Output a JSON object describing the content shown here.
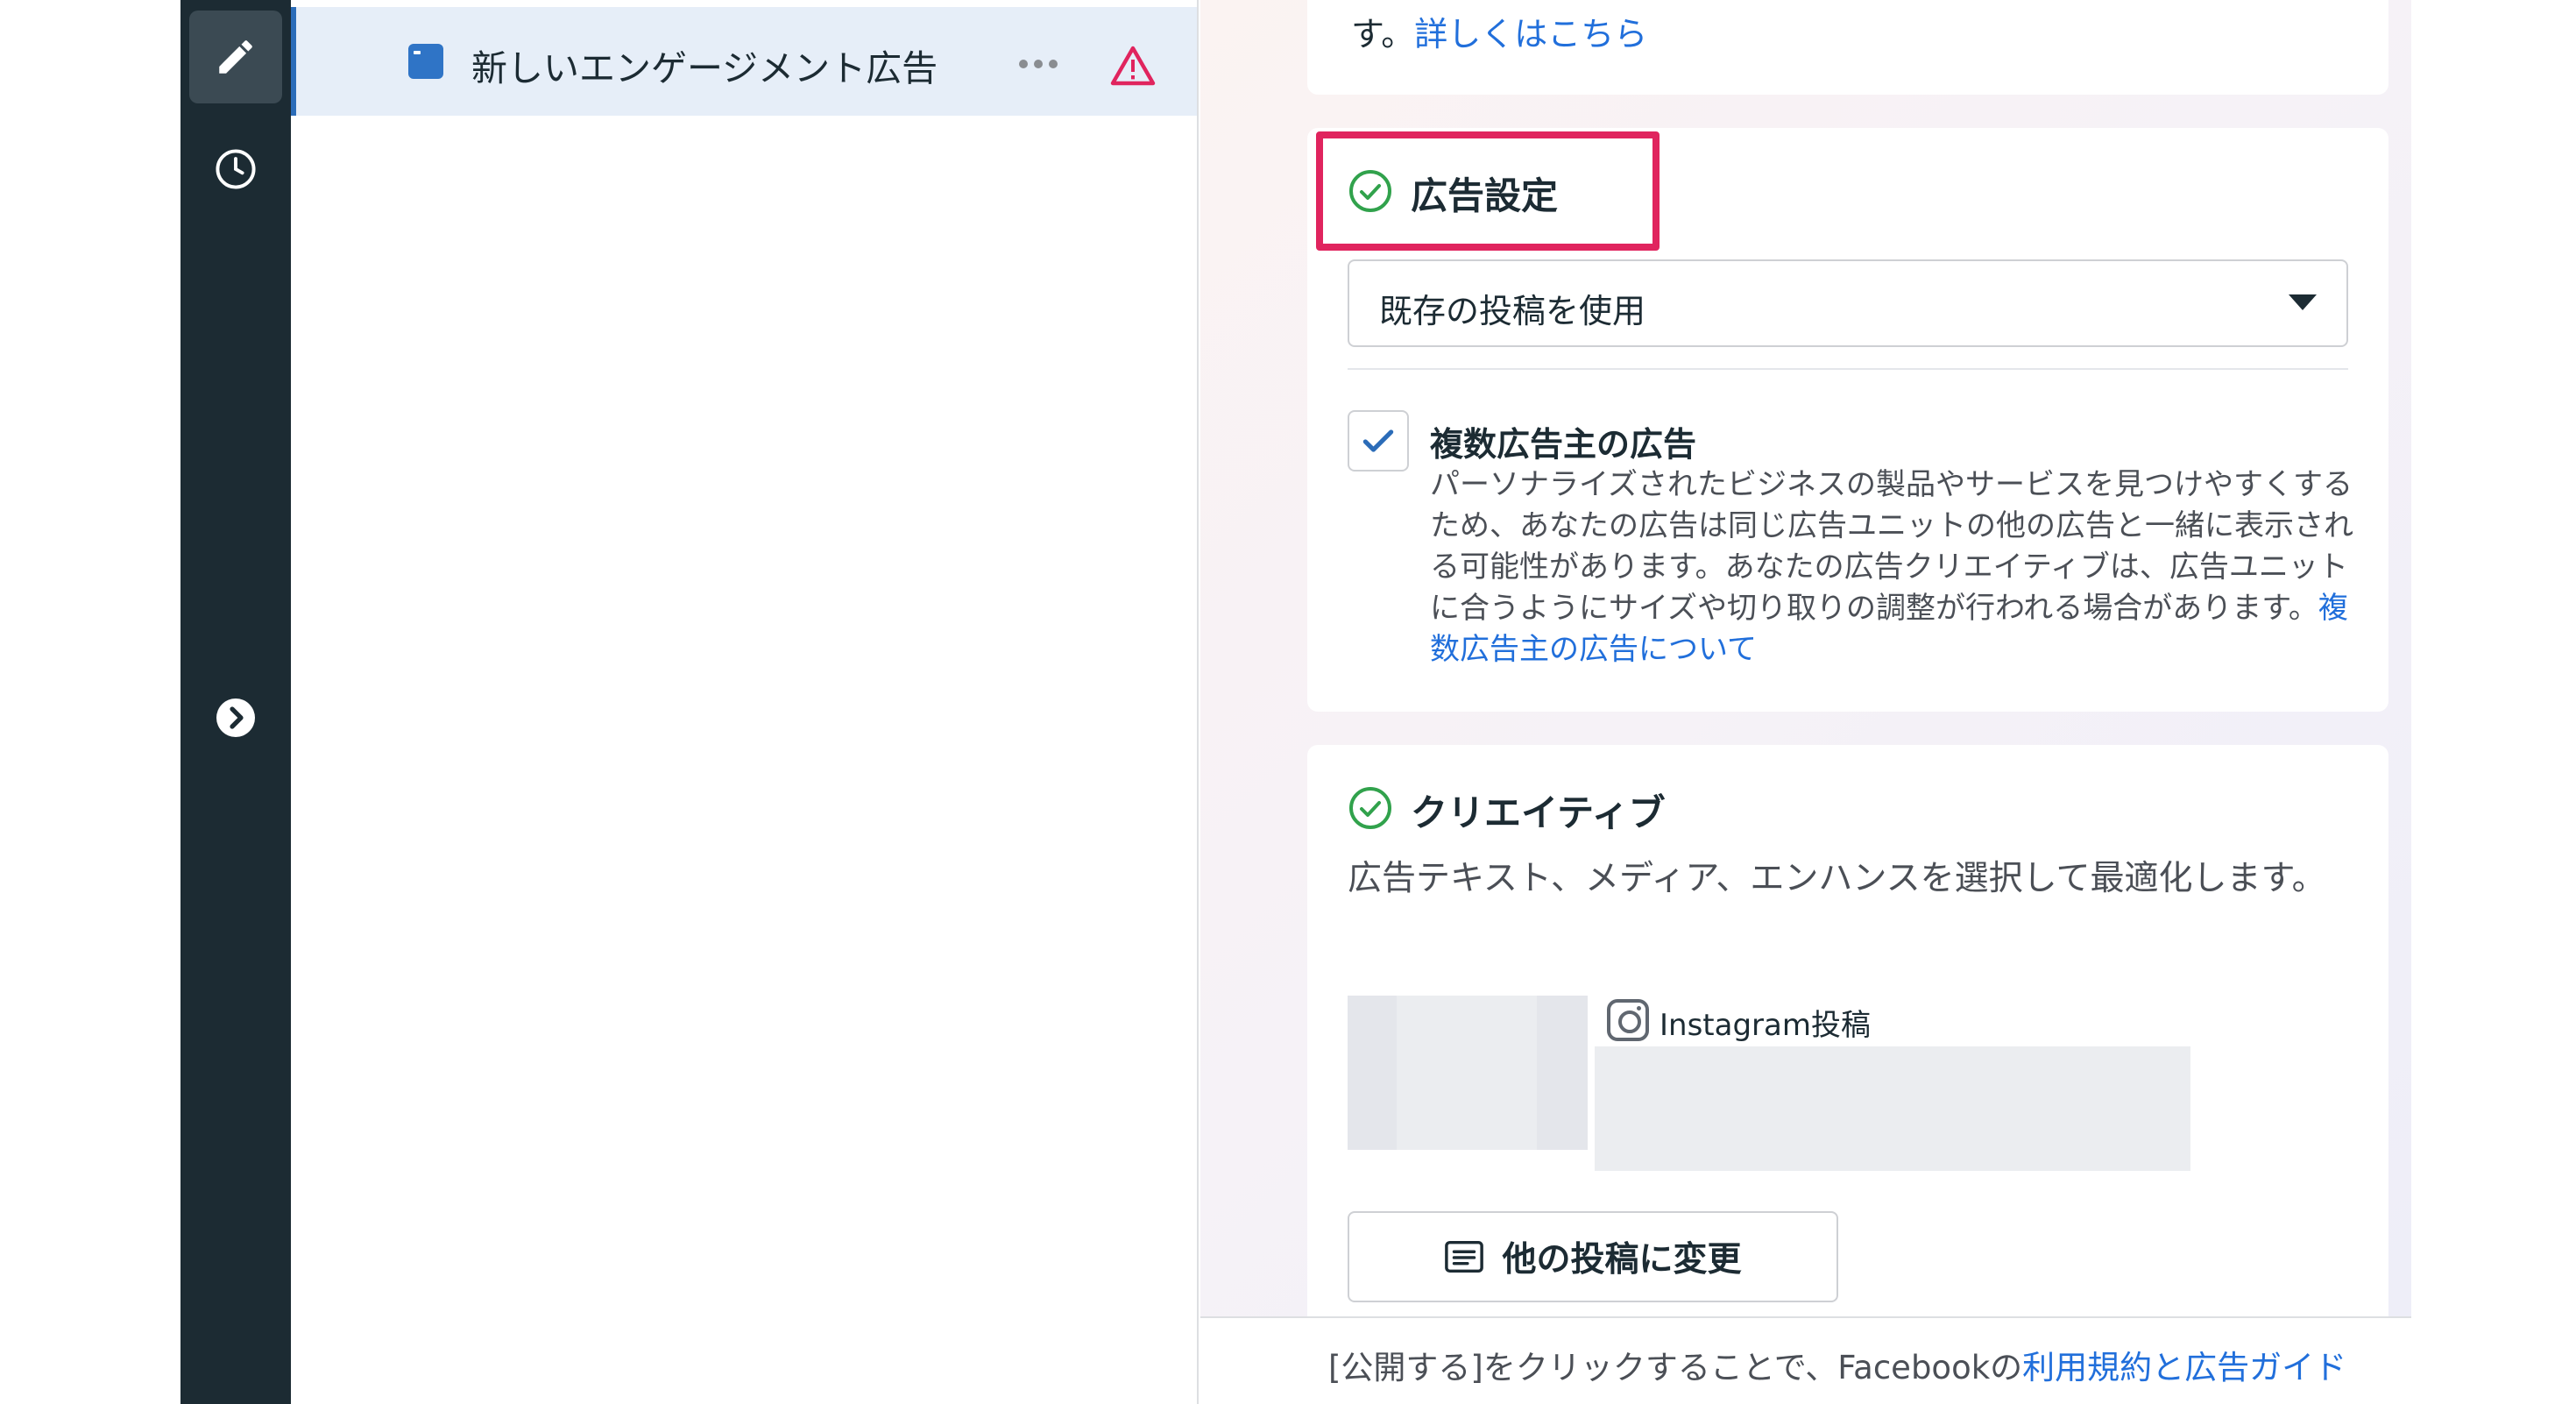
{
  "rail": {
    "items": [
      {
        "icon": "pencil-icon",
        "active": true
      },
      {
        "icon": "clock-icon",
        "active": false
      },
      {
        "icon": "chevron-right-circle-icon",
        "active": false
      }
    ]
  },
  "tree": {
    "ad_name": "新しいエンゲージメント広告",
    "more_icon": "more-horizontal-icon",
    "warning_icon": "warning-triangle-icon"
  },
  "top_card": {
    "text_prefix": "す。",
    "link_text": "詳しくはこちら"
  },
  "ad_settings": {
    "title": "広告設定",
    "select_value": "既存の投稿を使用",
    "multi_advertiser": {
      "checked": true,
      "title": "複数広告主の広告",
      "description": "パーソナライズされたビジネスの製品やサービスを見つけやすくするため、あなたの広告は同じ広告ユニットの他の広告と一緒に表示される可能性があります。あなたの広告クリエイティブは、広告ユニットに合うようにサイズや切り取りの調整が行われる場合があります。",
      "link_text": "複数広告主の広告について"
    }
  },
  "creative": {
    "title": "クリエイティブ",
    "description": "広告テキスト、メディア、エンハンスを選択して最適化します。",
    "post_type_label": "Instagram投稿",
    "change_button_label": "他の投稿に変更"
  },
  "footer": {
    "text_prefix": "[公開する]をクリックすることで、Facebookの",
    "link_text": "利用規約と広告ガイド"
  },
  "colors": {
    "rail_bg": "#1c2b33",
    "link": "#216fdb",
    "check_green": "#31a24c",
    "highlight": "#e0245e",
    "warning": "#e0245e"
  }
}
